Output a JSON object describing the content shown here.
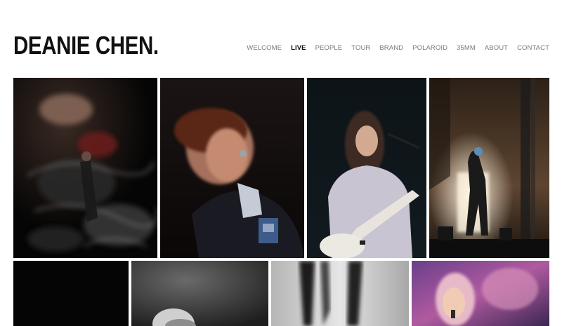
{
  "site": {
    "title": "DEANIE CHEN."
  },
  "nav": {
    "items": [
      {
        "label": "WELCOME",
        "active": false
      },
      {
        "label": "LIVE",
        "active": true
      },
      {
        "label": "PEOPLE",
        "active": false
      },
      {
        "label": "TOUR",
        "active": false
      },
      {
        "label": "BRAND",
        "active": false
      },
      {
        "label": "POLAROID",
        "active": false
      },
      {
        "label": "35MM",
        "active": false
      },
      {
        "label": "ABOUT",
        "active": false
      },
      {
        "label": "CONTACT",
        "active": false
      }
    ]
  },
  "colors": {
    "active_nav": "#111111",
    "inactive_nav": "#7a7a7a",
    "background": "#ffffff"
  }
}
